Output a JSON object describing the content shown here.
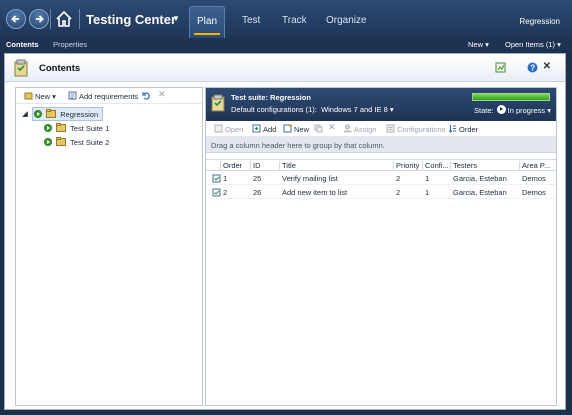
{
  "header": {
    "app_title": "Testing Center",
    "tabs": [
      "Plan",
      "Test",
      "Track",
      "Organize"
    ],
    "project": "Regression"
  },
  "subbar": {
    "items": [
      "Contents",
      "Properties"
    ],
    "new_label": "New",
    "open_items_label": "Open Items (1)"
  },
  "content": {
    "title": "Contents"
  },
  "left": {
    "toolbar": {
      "new_label": "New",
      "add_req_label": "Add requirements"
    },
    "tree": {
      "root": "Regression",
      "children": [
        "Test Suite 1",
        "Test Suite 2"
      ]
    }
  },
  "right": {
    "suite_label": "Test suite:",
    "suite_name": "Regression",
    "config_label": "Default configurations (1):",
    "config_value": "Windows 7 and IE 8",
    "state_label": "State:",
    "state_value": "In progress",
    "progress_percent": 100,
    "toolbar": {
      "open": "Open",
      "add": "Add",
      "new": "New",
      "assign": "Assign",
      "configurations": "Configurations",
      "order": "Order"
    },
    "group_hint": "Drag a column header here to group by that column.",
    "columns": [
      "Order",
      "ID",
      "Title",
      "Priority",
      "Confi...",
      "Testers",
      "Area P..."
    ],
    "rows": [
      {
        "order": "1",
        "id": "25",
        "title": "Verify mailing list",
        "priority": "2",
        "config": "1",
        "testers": "Garcia, Esteban",
        "area": "Demos"
      },
      {
        "order": "2",
        "id": "26",
        "title": "Add new item to list",
        "priority": "2",
        "config": "1",
        "testers": "Garcia, Esteban",
        "area": "Demos"
      }
    ]
  }
}
